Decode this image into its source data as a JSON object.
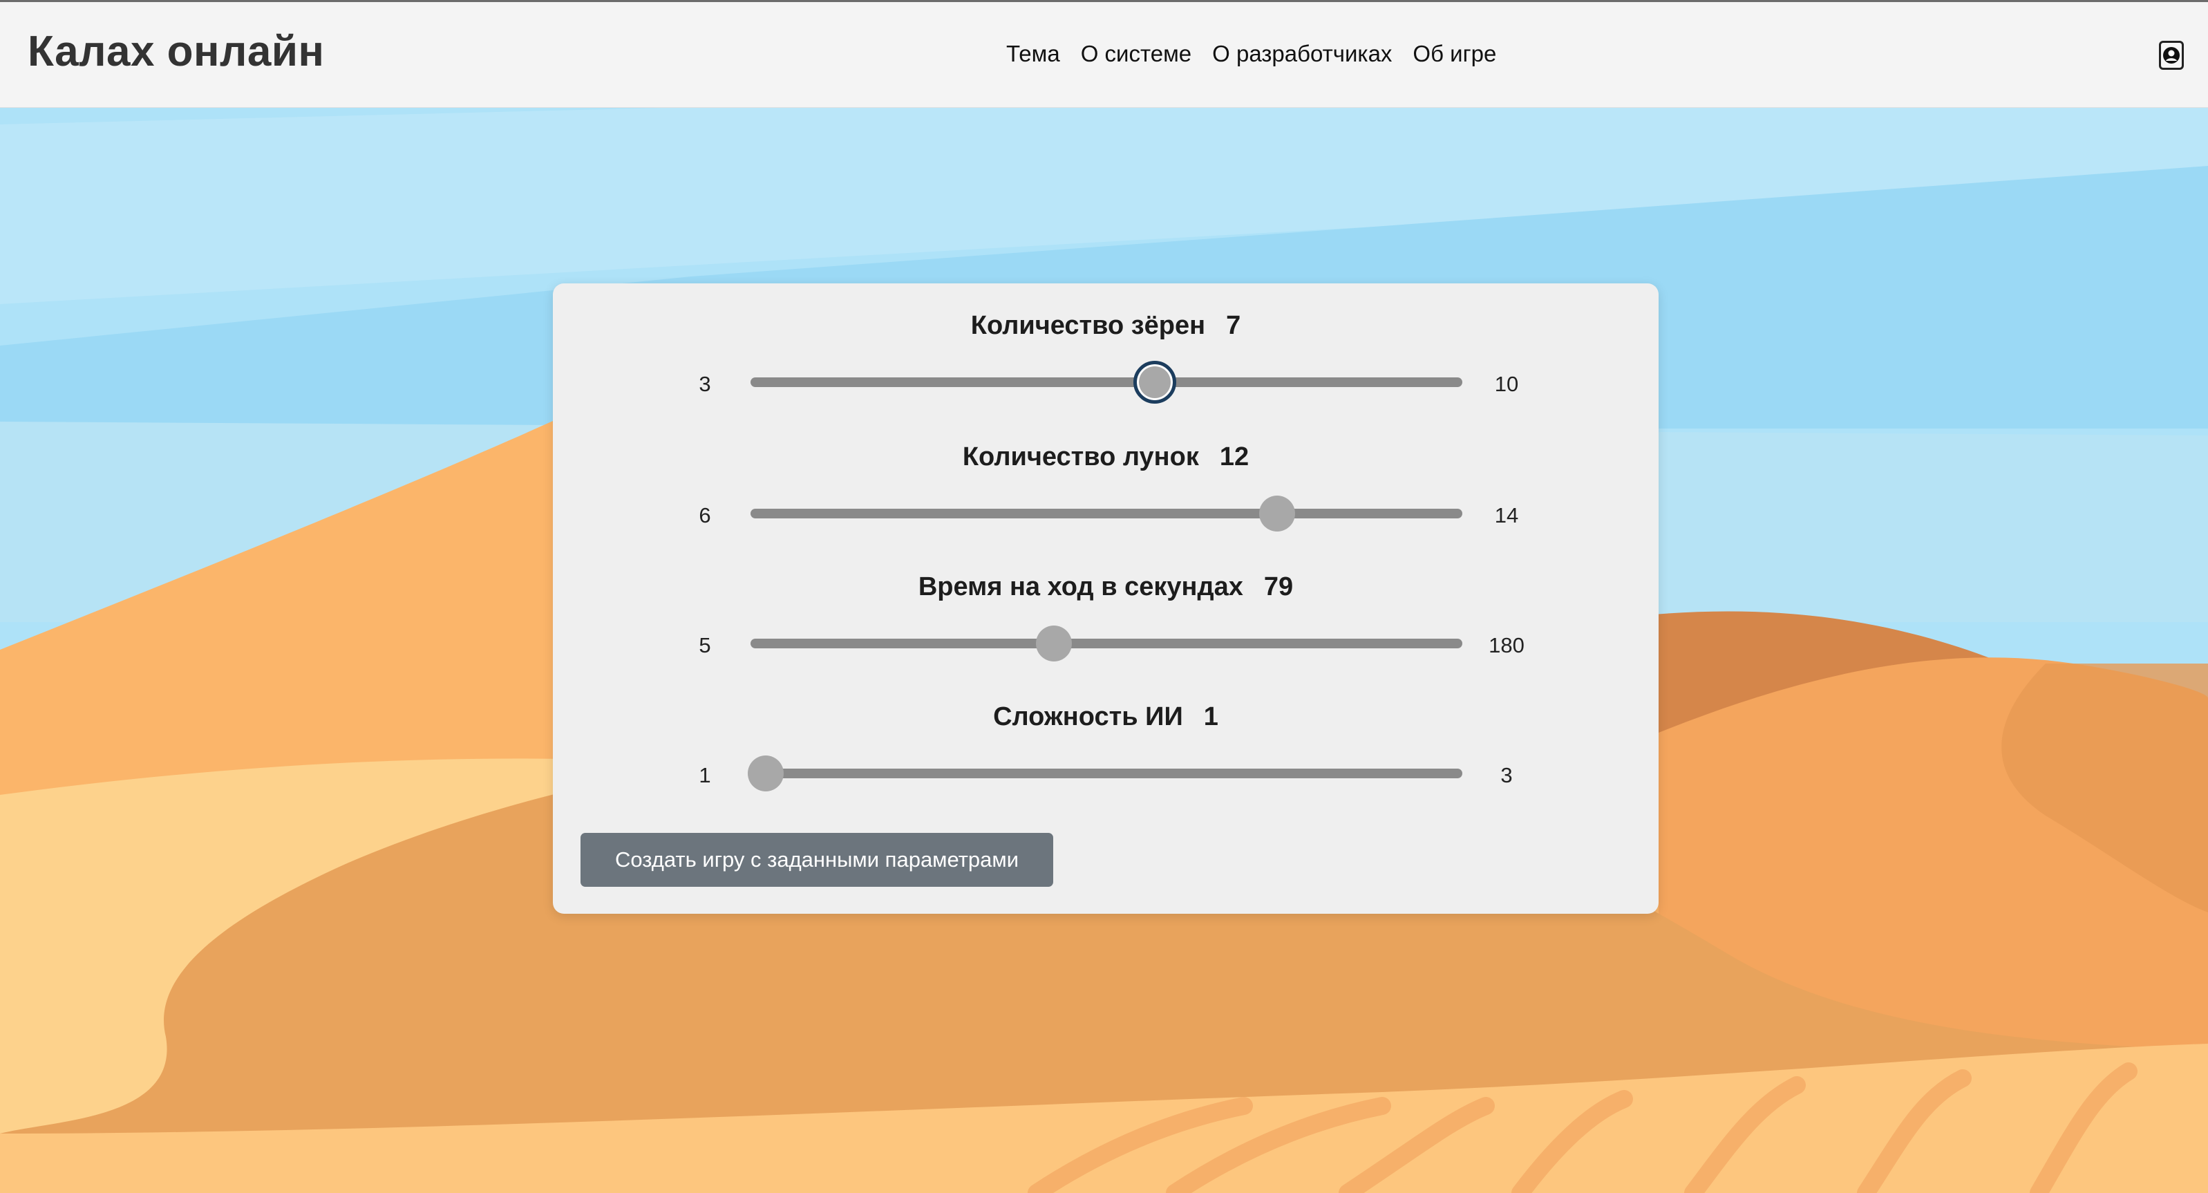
{
  "header": {
    "brand": "Калах онлайн",
    "nav": [
      "Тема",
      "О системе",
      "О разработчиках",
      "Об игре"
    ],
    "user_icon": "user-circle-icon"
  },
  "settings": [
    {
      "title": "Количество зёрен",
      "value": "7",
      "min": "3",
      "max": "10",
      "focused": true
    },
    {
      "title": "Количество лунок",
      "value": "12",
      "min": "6",
      "max": "14",
      "focused": false
    },
    {
      "title": "Время на ход в секундах",
      "value": "79",
      "min": "5",
      "max": "180",
      "focused": false
    },
    {
      "title": "Сложность ИИ",
      "value": "1",
      "min": "1",
      "max": "3",
      "focused": false
    }
  ],
  "create_button_label": "Создать игру с заданными параметрами",
  "colors": {
    "sky": "#aee2f8",
    "sand_light": "#fdd28c",
    "sand_mid": "#fbb56a",
    "sand_dark": "#d5864a",
    "button": "#6c757d",
    "panel": "#efefef"
  }
}
